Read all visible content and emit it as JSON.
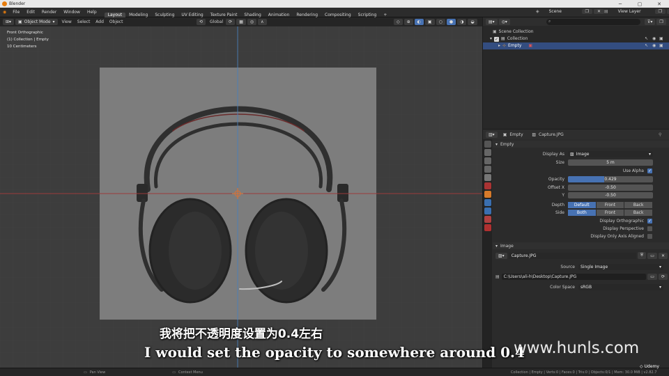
{
  "window": {
    "title": "Blender"
  },
  "menu": {
    "items": [
      "File",
      "Edit",
      "Render",
      "Window",
      "Help"
    ]
  },
  "workspaces": [
    "Layout",
    "Modeling",
    "Sculpting",
    "UV Editing",
    "Texture Paint",
    "Shading",
    "Animation",
    "Rendering",
    "Compositing",
    "Scripting"
  ],
  "active_workspace": "Layout",
  "topbar": {
    "scene": "Scene",
    "view_layer": "View Layer"
  },
  "viewport": {
    "mode": "Object Mode",
    "menus": [
      "View",
      "Select",
      "Add",
      "Object"
    ],
    "transform": "Global",
    "overlay_info": [
      "Front Orthographic",
      "(1) Collection | Empty",
      "10 Centimeters"
    ]
  },
  "outliner": {
    "search_placeholder": "",
    "items": [
      {
        "label": "Scene Collection"
      },
      {
        "label": "Collection"
      },
      {
        "label": "Empty"
      }
    ]
  },
  "properties": {
    "object_name": "Empty",
    "data_name": "Capture.JPG",
    "empty_panel": {
      "header": "Empty",
      "display_as_label": "Display As",
      "display_as_value": "Image",
      "size_label": "Size",
      "size_value": "5 m",
      "use_alpha_label": "Use Alpha",
      "opacity_label": "Opacity",
      "opacity_value": "0.429",
      "opacity_fraction": 0.429,
      "offset_x_label": "Offset X",
      "offset_x_value": "-0.50",
      "y_label": "Y",
      "y_value": "-0.50",
      "depth_label": "Depth",
      "depth_options": [
        "Default",
        "Front",
        "Back"
      ],
      "side_label": "Side",
      "side_options": [
        "Both",
        "Front",
        "Back"
      ],
      "display_orthographic": "Display Orthographic",
      "display_perspective": "Display Perspective",
      "display_axis_aligned": "Display Only Axis Aligned"
    },
    "image_panel": {
      "header": "Image",
      "image_name": "Capture.JPG",
      "source_label": "Source",
      "source_value": "Single Image",
      "path": "C:\\Users\\ali-h\\Desktop\\Capture.JPG",
      "color_space_label": "Color Space",
      "color_space_value": "sRGB"
    }
  },
  "status": {
    "pan": "Pan View",
    "context": "Context Menu",
    "stats": "Collection | Empty | Verts:0 | Faces:0 | Tris:0 | Objects:0/1 | Mem: 30.0 MiB | v2.82.7"
  },
  "subtitles": {
    "cn": "我将把不透明度设置为0.4左右",
    "en": "I would set the opacity to somewhere around 0.4"
  },
  "watermark": "www.hunls.com",
  "udemy": "Udemy",
  "colors": {
    "accent": "#4772b3",
    "x_axis": "#9b3b3b",
    "y_axis": "#4a7fb8",
    "empty_origin": "#e07030"
  }
}
